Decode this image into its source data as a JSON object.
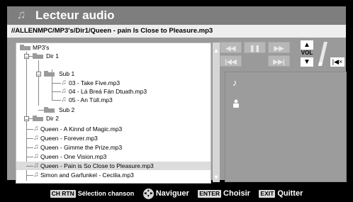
{
  "app": {
    "title": "Lecteur audio",
    "title_icon": "music-note-icon"
  },
  "path": "//ALLENMPC/MP3's/Dir1/Queen - pain Is Close to Pleasure.mp3",
  "tree": {
    "root_label": "MP3's",
    "folder_items": [
      {
        "label": "Dir 1"
      },
      {
        "label": "Sub 1"
      },
      {
        "label": "Sub 2"
      },
      {
        "label": "Dir 2"
      }
    ],
    "sub1_files": [
      {
        "label": "03 - Take Five.mp3"
      },
      {
        "label": "04 - Lá Breá Fán Dtuath.mp3"
      },
      {
        "label": "05 - An Tùll.mp3"
      }
    ],
    "files": [
      {
        "label": "Queen - A Kinnd of Magic.mp3"
      },
      {
        "label": "Queen - Forever.mp3"
      },
      {
        "label": "Queen - Gimme the Prize.mp3"
      },
      {
        "label": "Queen - One Vision.mp3"
      },
      {
        "label": "Queen - Pain is So Close to Pleasure.mp3",
        "selected": true
      },
      {
        "label": "Simon and Garfunkel - Cecilia.mp3"
      }
    ]
  },
  "player_controls": {
    "rewind": "◀◀",
    "pause": "❚❚",
    "fast_forward": "▶▶",
    "previous": "|◀◀",
    "next": "▶▶|"
  },
  "volume": {
    "label": "VOL",
    "up": "▲",
    "down": "▼",
    "mute": "|◀×"
  },
  "info_panel": {
    "note_icon": "♪"
  },
  "footer": {
    "hints": [
      {
        "key": "CH RTN",
        "text": "Sélection chanson"
      },
      {
        "key": "dpad",
        "text": "Naviguer"
      },
      {
        "key": "ENTER",
        "text": "Choisir"
      },
      {
        "key": "EXIT",
        "text": "Quitter"
      }
    ]
  },
  "colors": {
    "frame": "#9a9a9a",
    "title_bar": "#7e7e7e",
    "path_bar": "#eeeeee",
    "selection": "#dcdcdc",
    "info_panel": "#9c9c9c",
    "footer": "#000000"
  }
}
